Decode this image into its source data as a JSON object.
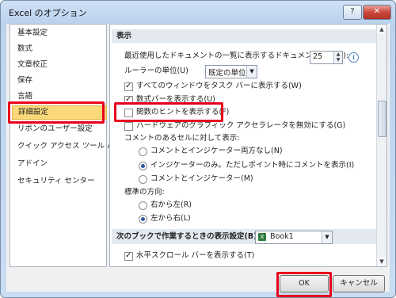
{
  "window": {
    "title": "Excel のオプション",
    "help": "?",
    "close": "✕"
  },
  "sidebar": {
    "items": [
      "基本設定",
      "数式",
      "文章校正",
      "保存",
      "言語",
      "詳細設定",
      "リボンのユーザー設定",
      "クイック アクセス ツール バー",
      "アドイン",
      "セキュリティ センター"
    ],
    "selected": "詳細設定"
  },
  "display": {
    "heading": "表示",
    "recent_docs_label": "最近使用したドキュメントの一覧に表示するドキュメントの数(R):",
    "recent_docs_value": "25",
    "ruler_label": "ルーラーの単位(U)",
    "ruler_value": "既定の単位",
    "show_all_windows": "すべてのウィンドウをタスク バーに表示する(W)",
    "show_formula_bar": "数式バーを表示する(U)",
    "show_function_tips": "関数のヒントを表示する(F)",
    "disable_hw_accel": "ハードウェアのグラフィック アクセラレータを無効にする(G)",
    "comments_label": "コメントのあるセルに対して表示:",
    "comments_none": "コメントとインジケーター両方なし(N)",
    "comments_indicator_only": "インジケーターのみ。ただしポイント時にコメントを表示(I)",
    "comments_both": "コメントとインジケーター(M)",
    "direction_label": "標準の方向:",
    "direction_rtl": "右から左(R)",
    "direction_ltr": "左から右(L)"
  },
  "workbook": {
    "heading": "次のブックで作業するときの表示設定(B):",
    "value": "Book1",
    "show_hscroll": "水平スクロール バーを表示する(T)"
  },
  "buttons": {
    "ok": "OK",
    "cancel": "キャンセル"
  },
  "state": {
    "show_all_windows": true,
    "show_formula_bar": true,
    "show_function_tips": false,
    "disable_hw_accel": false,
    "comments": "indicator_only",
    "direction": "ltr",
    "show_hscroll": true
  },
  "colors": {
    "highlight": "#e8001c",
    "selected_item": "#fbd97a"
  }
}
